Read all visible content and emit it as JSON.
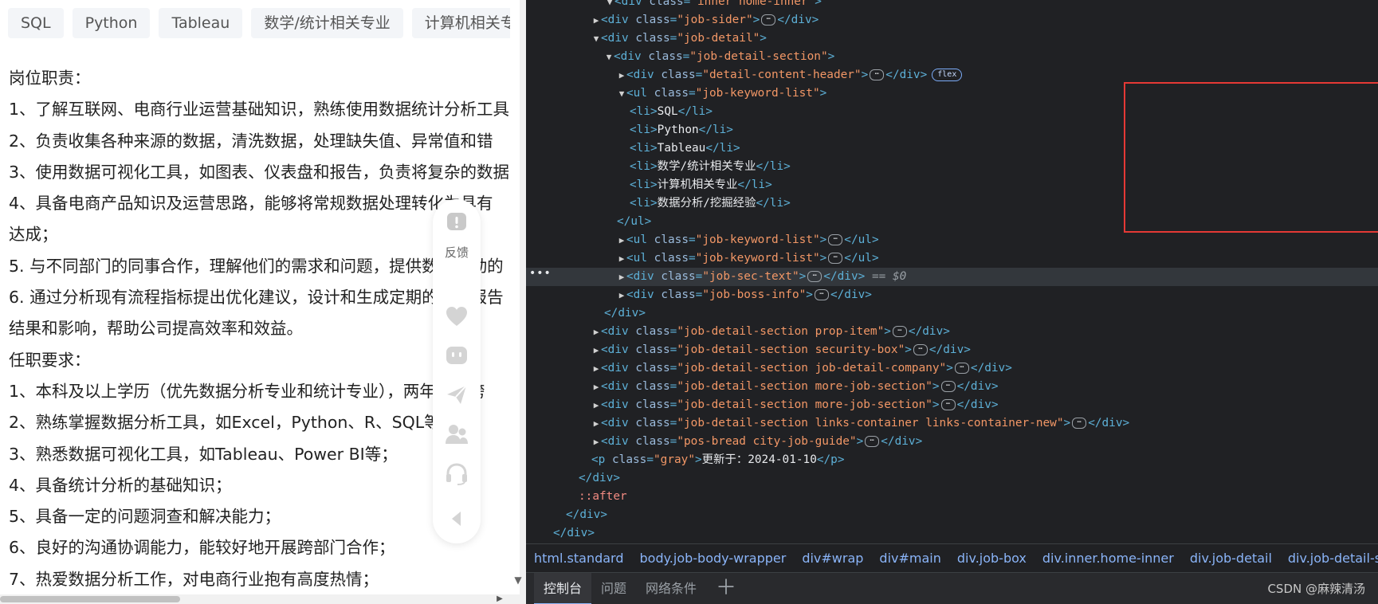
{
  "job_page": {
    "keyword_tags": [
      "SQL",
      "Python",
      "Tableau",
      "数学/统计相关专业",
      "计算机相关专业"
    ],
    "description_lines": [
      "岗位职责：",
      "1、了解互联网、电商行业运营基础知识，熟练使用数据统计分析工具",
      "2、负责收集各种来源的数据，清洗数据，处理缺失值、异常值和错",
      "3、使用数据可视化工具，如图表、仪表盘和报告，负责将复杂的数据",
      "4、具备电商产品知识及运营思路，能够将常规数据处理转化为具有",
      "达成；",
      "5. 与不同部门的同事合作，理解他们的需求和问题，提供数据驱动的",
      "6. 通过分析现有流程指标提出优化建议，设计和生成定期的数据报告",
      "结果和影响，帮助公司提高效率和效益。",
      "任职要求：",
      "1、本科及以上学历（优先数据分析专业和统计专业），两年以上跨",
      "2、熟练掌握数据分析工具，如Excel，Python、R、SQL等；",
      "3、熟悉数据可视化工具，如Tableau、Power BI等；",
      "4、具备统计分析的基础知识；",
      "5、具备一定的问题洞查和解决能力；",
      "6、良好的沟通协调能力，能较好地开展跨部门合作；",
      "7、热爱数据分析工作，对电商行业抱有高度热情；"
    ],
    "feedback_label": "反馈"
  },
  "devtools": {
    "dom_lines": [
      {
        "tri": "▼",
        "tag": "div",
        "cls": "inner home-inner",
        "kind": "open"
      },
      {
        "tri": "▶",
        "tag": "div",
        "cls": "job-sider",
        "kind": "collapsed"
      },
      {
        "tri": "▼",
        "tag": "div",
        "cls": "job-detail",
        "kind": "open"
      },
      {
        "tri": "▼",
        "tag": "div",
        "cls": "job-detail-section",
        "kind": "open"
      },
      {
        "tri": "▶",
        "tag": "div",
        "cls": "detail-content-header",
        "kind": "collapsed",
        "badge": "flex"
      },
      {
        "tri": "▼",
        "tag": "ul",
        "cls": "job-keyword-list",
        "kind": "open"
      },
      {
        "tag": "li",
        "text": "SQL",
        "kind": "inline"
      },
      {
        "tag": "li",
        "text": "Python",
        "kind": "inline"
      },
      {
        "tag": "li",
        "text": "Tableau",
        "kind": "inline"
      },
      {
        "tag": "li",
        "text": "数学/统计相关专业",
        "kind": "inline"
      },
      {
        "tag": "li",
        "text": "计算机相关专业",
        "kind": "inline"
      },
      {
        "tag": "li",
        "text": "数据分析/挖掘经验",
        "kind": "inline"
      },
      {
        "tag": "ul",
        "kind": "close"
      },
      {
        "tri": "▶",
        "tag": "ul",
        "cls": "job-keyword-list",
        "kind": "collapsed"
      },
      {
        "tri": "▶",
        "tag": "ul",
        "cls": "job-keyword-list",
        "kind": "collapsed"
      },
      {
        "tri": "▶",
        "tag": "div",
        "cls": "job-sec-text",
        "kind": "collapsed",
        "selected": true,
        "suffix": "== $0"
      },
      {
        "tri": "▶",
        "tag": "div",
        "cls": "job-boss-info",
        "kind": "collapsed"
      },
      {
        "tag": "div",
        "kind": "close"
      },
      {
        "tri": "▶",
        "tag": "div",
        "cls": "job-detail-section prop-item",
        "kind": "collapsed"
      },
      {
        "tri": "▶",
        "tag": "div",
        "cls": "job-detail-section security-box",
        "kind": "collapsed"
      },
      {
        "tri": "▶",
        "tag": "div",
        "cls": "job-detail-section job-detail-company",
        "kind": "collapsed"
      },
      {
        "tri": "▶",
        "tag": "div",
        "cls": "job-detail-section more-job-section",
        "kind": "collapsed"
      },
      {
        "tri": "▶",
        "tag": "div",
        "cls": "job-detail-section more-job-section",
        "kind": "collapsed"
      },
      {
        "tri": "▶",
        "tag": "div",
        "cls": "job-detail-section links-container links-container-new",
        "kind": "collapsed"
      },
      {
        "tri": "▶",
        "tag": "div",
        "cls": "pos-bread city-job-guide",
        "kind": "collapsed"
      },
      {
        "tag": "p",
        "cls": "gray",
        "text": "更新于：2024-01-10",
        "kind": "pinline"
      },
      {
        "tag": "div",
        "kind": "close"
      },
      {
        "kind": "pseudo",
        "text": "::after"
      },
      {
        "tag": "div",
        "kind": "close"
      },
      {
        "tag": "div",
        "kind": "close"
      }
    ],
    "gutter_dots": "•••",
    "breadcrumbs": [
      "html.standard",
      "body.job-body-wrapper",
      "div#wrap",
      "div#main",
      "div.job-box",
      "div.inner.home-inner",
      "div.job-detail",
      "div.job-detail-section"
    ],
    "drawer_tabs": [
      "控制台",
      "问题",
      "网络条件"
    ],
    "add_tab_glyph": "＋",
    "watermark": "CSDN @麻辣清汤"
  },
  "colors": {
    "devtools_bg": "#202124",
    "tag_bracket": "#5db0d7",
    "attr_name": "#9bbbdc",
    "attr_value": "#f29766",
    "highlight_box": "#e53935",
    "breadcrumb_link": "#8ab4f8"
  },
  "icons": [
    "feedback-alert-icon",
    "heart-icon",
    "chat-icon",
    "send-icon",
    "users-icon",
    "headset-icon",
    "collapse-triangle-icon"
  ]
}
